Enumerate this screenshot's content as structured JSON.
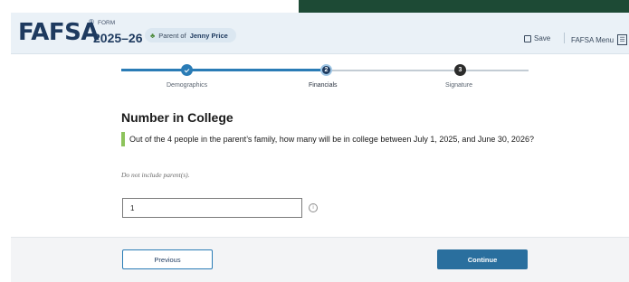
{
  "header": {
    "logo": "FAFSA",
    "registered": "®",
    "form_label": "FORM",
    "form_year": "2025–26",
    "role_prefix": "Parent of",
    "student_name": "Jenny Price",
    "save_label": "Save",
    "menu_label": "FAFSA Menu",
    "menu_glyph": "☰"
  },
  "progress": {
    "steps": [
      {
        "label": "Demographics",
        "status": "complete"
      },
      {
        "label": "Financials",
        "number": "2",
        "status": "current"
      },
      {
        "label": "Signature",
        "number": "3",
        "status": "upcoming"
      }
    ]
  },
  "main": {
    "title": "Number in College",
    "question": "Out of the 4 people in the parent’s family, how many will be in college between July 1, 2025, and June 30, 2026?",
    "hint": "Do not include parent(s).",
    "answer_value": "1",
    "info_glyph": "i"
  },
  "footer": {
    "previous_label": "Previous",
    "continue_label": "Continue"
  },
  "colors": {
    "brand_navy": "#1e3a5f",
    "accent_blue": "#2a7cb6",
    "continue_blue": "#2a6f9e",
    "question_border": "#8dc35c",
    "backdrop_green": "#1d4a35"
  },
  "icons": [
    "people-icon",
    "save-icon",
    "menu-icon",
    "check-icon",
    "info-icon"
  ]
}
